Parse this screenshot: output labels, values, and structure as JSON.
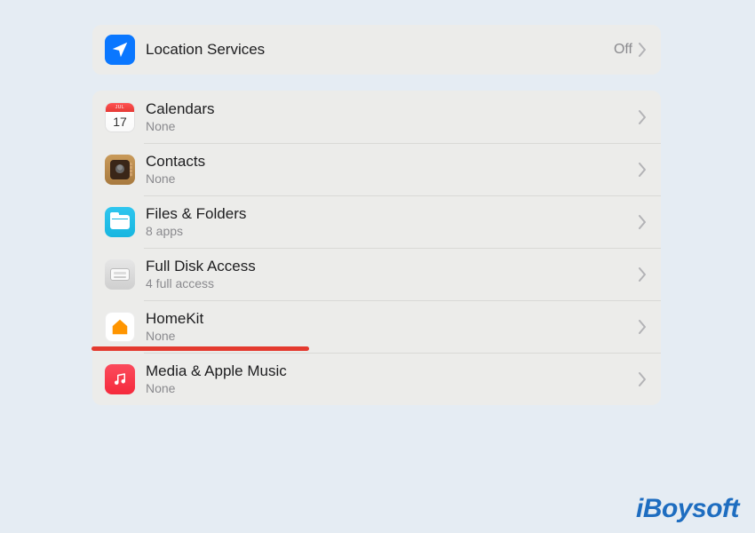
{
  "location": {
    "title": "Location Services",
    "value": "Off"
  },
  "calendar_icon": {
    "month": "JUL",
    "day": "17"
  },
  "privacy_items": [
    {
      "key": "calendars",
      "title": "Calendars",
      "subtitle": "None",
      "icon": "calendar"
    },
    {
      "key": "contacts",
      "title": "Contacts",
      "subtitle": "None",
      "icon": "contacts"
    },
    {
      "key": "files",
      "title": "Files & Folders",
      "subtitle": "8 apps",
      "icon": "files"
    },
    {
      "key": "fulldisk",
      "title": "Full Disk Access",
      "subtitle": "4 full access",
      "icon": "disk"
    },
    {
      "key": "homekit",
      "title": "HomeKit",
      "subtitle": "None",
      "icon": "homekit"
    },
    {
      "key": "media",
      "title": "Media & Apple Music",
      "subtitle": "None",
      "icon": "music"
    }
  ],
  "watermark": "iBoysoft"
}
